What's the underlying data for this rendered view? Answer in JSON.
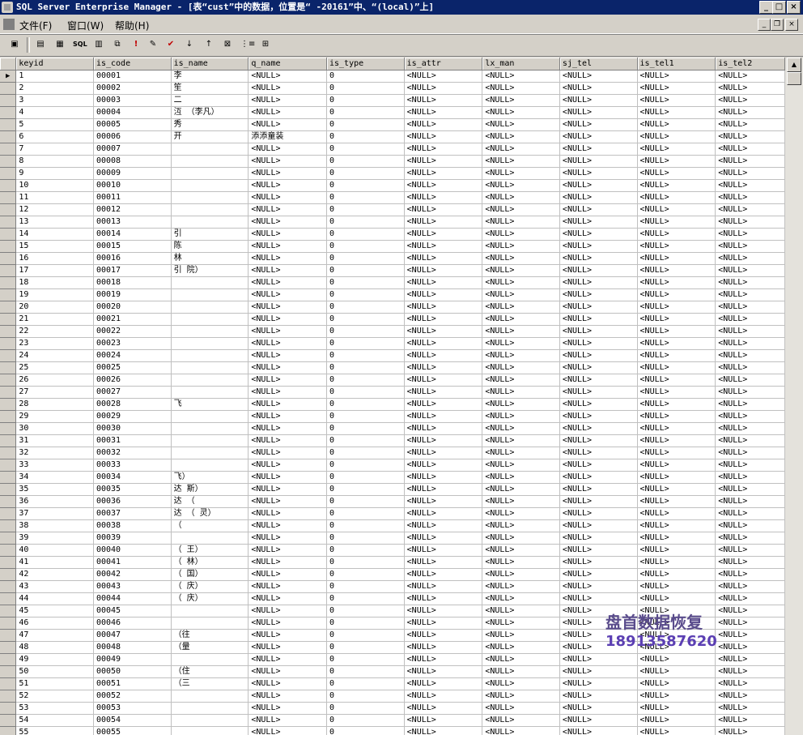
{
  "window": {
    "title": "SQL Server Enterprise Manager - [表“cust”中的数据，位置是“ -20161”中、“(local)”上]",
    "min_label": "_",
    "max_label": "□",
    "close_label": "×"
  },
  "menu": {
    "items": [
      "文件(F)",
      "窗口(W)",
      "帮助(H)"
    ],
    "mdi_min": "_",
    "mdi_restore": "❐",
    "mdi_close": "×"
  },
  "toolbar": {
    "icons": [
      "properties-icon",
      "show-diagram-icon",
      "show-grid-icon",
      "show-sql-icon",
      "show-results-icon",
      "change-type-icon",
      "run-icon",
      "verify-sql-icon",
      "remove-filter-icon",
      "sort-ascending-icon",
      "sort-descending-icon",
      "remove-filter-icon-2",
      "group-by-icon",
      "add-table-icon"
    ]
  },
  "grid": {
    "columns": [
      "keyid",
      "is_code",
      "is_name",
      "q_name",
      "is_type",
      "is_attr",
      "lx_man",
      "sj_tel",
      "is_tel1",
      "is_tel2"
    ],
    "null_text": "<NULL>",
    "current_row_marker": "▶",
    "rows": [
      {
        "keyid": "1",
        "is_code": "00001",
        "is_name": "李",
        "q_name": "<NULL>",
        "is_type": "0"
      },
      {
        "keyid": "2",
        "is_code": "00002",
        "is_name": "笙",
        "q_name": "<NULL>",
        "is_type": "0"
      },
      {
        "keyid": "3",
        "is_code": "00003",
        "is_name": "二",
        "q_name": "<NULL>",
        "is_type": "0"
      },
      {
        "keyid": "4",
        "is_code": "00004",
        "is_name": "沍 （李凡）",
        "q_name": "<NULL>",
        "is_type": "0"
      },
      {
        "keyid": "5",
        "is_code": "00005",
        "is_name": "秀",
        "q_name": "<NULL>",
        "is_type": "0"
      },
      {
        "keyid": "6",
        "is_code": "00006",
        "is_name": "开",
        "q_name": "添添童装",
        "is_type": "0"
      },
      {
        "keyid": "7",
        "is_code": "00007",
        "is_name": "",
        "q_name": "<NULL>",
        "is_type": "0"
      },
      {
        "keyid": "8",
        "is_code": "00008",
        "is_name": "",
        "q_name": "<NULL>",
        "is_type": "0"
      },
      {
        "keyid": "9",
        "is_code": "00009",
        "is_name": "",
        "q_name": "<NULL>",
        "is_type": "0"
      },
      {
        "keyid": "10",
        "is_code": "00010",
        "is_name": "",
        "q_name": "<NULL>",
        "is_type": "0"
      },
      {
        "keyid": "11",
        "is_code": "00011",
        "is_name": "",
        "q_name": "<NULL>",
        "is_type": "0"
      },
      {
        "keyid": "12",
        "is_code": "00012",
        "is_name": "",
        "q_name": "<NULL>",
        "is_type": "0"
      },
      {
        "keyid": "13",
        "is_code": "00013",
        "is_name": "",
        "q_name": "<NULL>",
        "is_type": "0"
      },
      {
        "keyid": "14",
        "is_code": "00014",
        "is_name": "引",
        "q_name": "<NULL>",
        "is_type": "0"
      },
      {
        "keyid": "15",
        "is_code": "00015",
        "is_name": "陈",
        "q_name": "<NULL>",
        "is_type": "0"
      },
      {
        "keyid": "16",
        "is_code": "00016",
        "is_name": "林",
        "q_name": "<NULL>",
        "is_type": "0"
      },
      {
        "keyid": "17",
        "is_code": "00017",
        "is_name": "引 院）",
        "q_name": "<NULL>",
        "is_type": "0"
      },
      {
        "keyid": "18",
        "is_code": "00018",
        "is_name": "",
        "q_name": "<NULL>",
        "is_type": "0"
      },
      {
        "keyid": "19",
        "is_code": "00019",
        "is_name": "",
        "q_name": "<NULL>",
        "is_type": "0"
      },
      {
        "keyid": "20",
        "is_code": "00020",
        "is_name": "",
        "q_name": "<NULL>",
        "is_type": "0"
      },
      {
        "keyid": "21",
        "is_code": "00021",
        "is_name": "",
        "q_name": "<NULL>",
        "is_type": "0"
      },
      {
        "keyid": "22",
        "is_code": "00022",
        "is_name": "",
        "q_name": "<NULL>",
        "is_type": "0"
      },
      {
        "keyid": "23",
        "is_code": "00023",
        "is_name": "",
        "q_name": "<NULL>",
        "is_type": "0"
      },
      {
        "keyid": "24",
        "is_code": "00024",
        "is_name": "",
        "q_name": "<NULL>",
        "is_type": "0"
      },
      {
        "keyid": "25",
        "is_code": "00025",
        "is_name": "",
        "q_name": "<NULL>",
        "is_type": "0"
      },
      {
        "keyid": "26",
        "is_code": "00026",
        "is_name": "",
        "q_name": "<NULL>",
        "is_type": "0"
      },
      {
        "keyid": "27",
        "is_code": "00027",
        "is_name": "",
        "q_name": "<NULL>",
        "is_type": "0"
      },
      {
        "keyid": "28",
        "is_code": "00028",
        "is_name": "飞",
        "q_name": "<NULL>",
        "is_type": "0"
      },
      {
        "keyid": "29",
        "is_code": "00029",
        "is_name": "",
        "q_name": "<NULL>",
        "is_type": "0"
      },
      {
        "keyid": "30",
        "is_code": "00030",
        "is_name": "",
        "q_name": "<NULL>",
        "is_type": "0"
      },
      {
        "keyid": "31",
        "is_code": "00031",
        "is_name": "",
        "q_name": "<NULL>",
        "is_type": "0"
      },
      {
        "keyid": "32",
        "is_code": "00032",
        "is_name": "",
        "q_name": "<NULL>",
        "is_type": "0"
      },
      {
        "keyid": "33",
        "is_code": "00033",
        "is_name": "",
        "q_name": "<NULL>",
        "is_type": "0"
      },
      {
        "keyid": "34",
        "is_code": "00034",
        "is_name": "飞）",
        "q_name": "<NULL>",
        "is_type": "0"
      },
      {
        "keyid": "35",
        "is_code": "00035",
        "is_name": "达 斯）",
        "q_name": "<NULL>",
        "is_type": "0"
      },
      {
        "keyid": "36",
        "is_code": "00036",
        "is_name": "达 （",
        "q_name": "<NULL>",
        "is_type": "0"
      },
      {
        "keyid": "37",
        "is_code": "00037",
        "is_name": "达 （ 灵）",
        "q_name": "<NULL>",
        "is_type": "0"
      },
      {
        "keyid": "38",
        "is_code": "00038",
        "is_name": "（",
        "q_name": "<NULL>",
        "is_type": "0"
      },
      {
        "keyid": "39",
        "is_code": "00039",
        "is_name": "",
        "q_name": "<NULL>",
        "is_type": "0"
      },
      {
        "keyid": "40",
        "is_code": "00040",
        "is_name": "（ 王）",
        "q_name": "<NULL>",
        "is_type": "0"
      },
      {
        "keyid": "41",
        "is_code": "00041",
        "is_name": "（ 林）",
        "q_name": "<NULL>",
        "is_type": "0"
      },
      {
        "keyid": "42",
        "is_code": "00042",
        "is_name": "（ 国）",
        "q_name": "<NULL>",
        "is_type": "0"
      },
      {
        "keyid": "43",
        "is_code": "00043",
        "is_name": "（ 庆）",
        "q_name": "<NULL>",
        "is_type": "0"
      },
      {
        "keyid": "44",
        "is_code": "00044",
        "is_name": "（ 庆）",
        "q_name": "<NULL>",
        "is_type": "0"
      },
      {
        "keyid": "45",
        "is_code": "00045",
        "is_name": "",
        "q_name": "<NULL>",
        "is_type": "0"
      },
      {
        "keyid": "46",
        "is_code": "00046",
        "is_name": "",
        "q_name": "<NULL>",
        "is_type": "0"
      },
      {
        "keyid": "47",
        "is_code": "00047",
        "is_name": "（往",
        "q_name": "<NULL>",
        "is_type": "0"
      },
      {
        "keyid": "48",
        "is_code": "00048",
        "is_name": "（量",
        "q_name": "<NULL>",
        "is_type": "0"
      },
      {
        "keyid": "49",
        "is_code": "00049",
        "is_name": "",
        "q_name": "<NULL>",
        "is_type": "0"
      },
      {
        "keyid": "50",
        "is_code": "00050",
        "is_name": "（住",
        "q_name": "<NULL>",
        "is_type": "0"
      },
      {
        "keyid": "51",
        "is_code": "00051",
        "is_name": "（三",
        "q_name": "<NULL>",
        "is_type": "0"
      },
      {
        "keyid": "52",
        "is_code": "00052",
        "is_name": "",
        "q_name": "<NULL>",
        "is_type": "0"
      },
      {
        "keyid": "53",
        "is_code": "00053",
        "is_name": "",
        "q_name": "<NULL>",
        "is_type": "0"
      },
      {
        "keyid": "54",
        "is_code": "00054",
        "is_name": "",
        "q_name": "<NULL>",
        "is_type": "0"
      },
      {
        "keyid": "55",
        "is_code": "00055",
        "is_name": "",
        "q_name": "<NULL>",
        "is_type": "0"
      }
    ]
  },
  "watermark": {
    "line1": "盘首数据恢复",
    "line2": "18913587620"
  },
  "scrollbar": {
    "up": "▲"
  }
}
